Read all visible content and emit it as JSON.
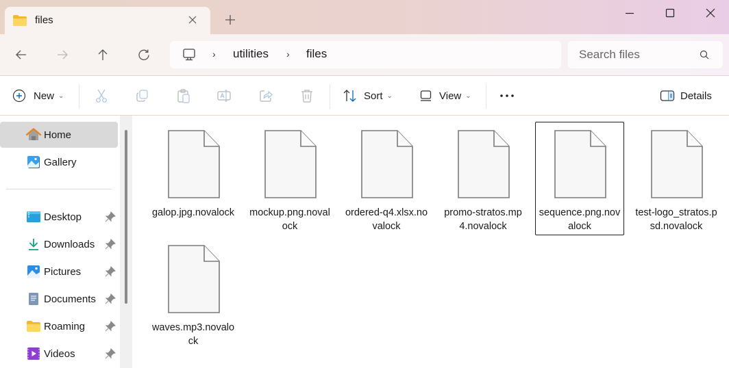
{
  "window": {
    "tab_title": "files",
    "tab_icon": "folder-icon",
    "new_tab_label": "+",
    "controls": [
      "minimize",
      "maximize",
      "close"
    ]
  },
  "nav": {
    "back": "back-arrow-icon",
    "forward": "forward-arrow-icon",
    "up": "up-arrow-icon",
    "refresh": "refresh-icon",
    "breadcrumb": [
      {
        "label": "utilities"
      },
      {
        "label": "files"
      }
    ],
    "breadcrumb_separator": "›",
    "search": {
      "placeholder": "Search files",
      "value": ""
    }
  },
  "toolbar": {
    "new_label": "New",
    "sort_label": "Sort",
    "view_label": "View",
    "more_label": "•••",
    "details_label": "Details",
    "actions": [
      "cut",
      "copy",
      "paste",
      "rename",
      "share",
      "delete"
    ]
  },
  "sidebar": {
    "top_items": [
      {
        "label": "Home",
        "icon": "home-icon",
        "active": true
      },
      {
        "label": "Gallery",
        "icon": "gallery-icon",
        "active": false
      }
    ],
    "pinned_items": [
      {
        "label": "Desktop",
        "icon": "desktop-icon"
      },
      {
        "label": "Downloads",
        "icon": "downloads-icon"
      },
      {
        "label": "Pictures",
        "icon": "pictures-icon"
      },
      {
        "label": "Documents",
        "icon": "documents-icon"
      },
      {
        "label": "Roaming",
        "icon": "folder-icon"
      },
      {
        "label": "Videos",
        "icon": "videos-icon"
      }
    ]
  },
  "files": [
    {
      "name": "galop.jpg.novalock",
      "selected": false
    },
    {
      "name": "mockup.png.novalock",
      "selected": false
    },
    {
      "name": "ordered-q4.xlsx.novalock",
      "selected": false
    },
    {
      "name": "promo-stratos.mp4.novalock",
      "selected": false
    },
    {
      "name": "sequence.png.novalock",
      "selected": true
    },
    {
      "name": "test-logo_stratos.psd.novalock",
      "selected": false
    },
    {
      "name": "waves.mp3.novalock",
      "selected": false
    }
  ],
  "colors": {
    "accent": "#0067c0",
    "selected_border": "#1f1f1f",
    "sidebar_active": "#d9d9d9",
    "folder_yellow": "#f5c842"
  }
}
